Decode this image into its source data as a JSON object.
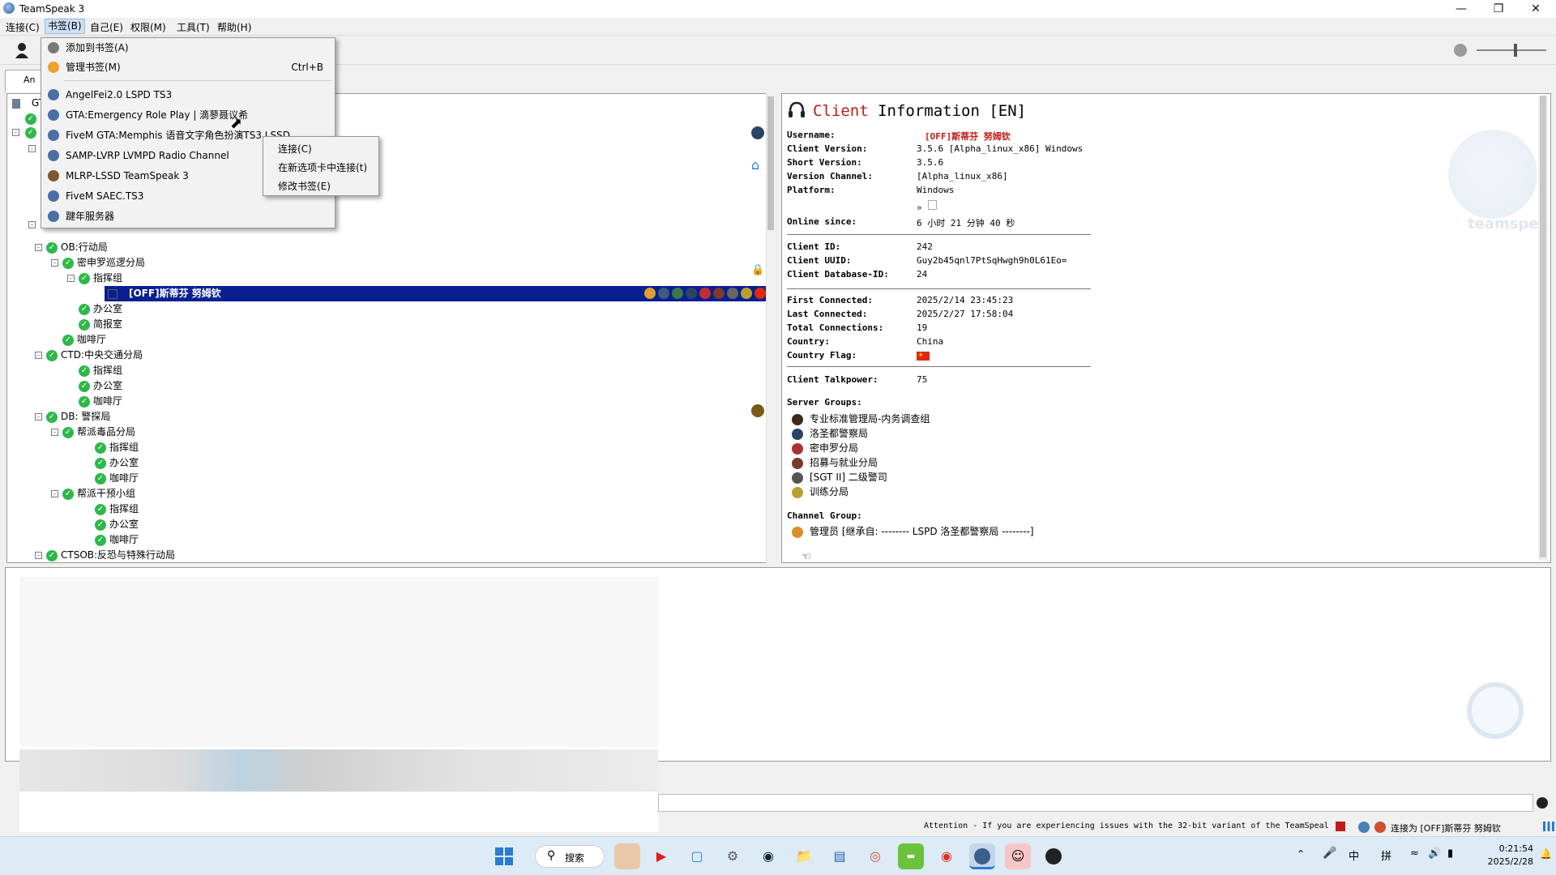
{
  "window": {
    "title": "TeamSpeak 3"
  },
  "menubar": {
    "items": [
      "连接(C)",
      "书签(B)",
      "自己(E)",
      "权限(M)",
      "工具(T)",
      "帮助(H)"
    ]
  },
  "tab": {
    "label": "An"
  },
  "bookmarks_menu": {
    "add": "添加到书签(A)",
    "manage": "管理书签(M)",
    "manage_shortcut": "Ctrl+B",
    "items": [
      "AngelFei2.0 LSPD TS3",
      "GTA:Emergency Role Play | 滴蓼聂议希",
      "FiveM GTA:Memphis 语音文字角色扮演TS3 LSSD",
      "SAMP-LVRP LVMPD Radio Channel",
      "MLRP-LSSD TeamSpeak 3",
      "FiveM SAEC.TS3",
      "踺年服务器"
    ]
  },
  "submenu": {
    "items": [
      "连接(C)",
      "在新选项卡中连接(t)",
      "修改书签(E)"
    ]
  },
  "tree": {
    "top_label": "GTA",
    "nodes": [
      {
        "label": "OB:行动局",
        "level": 1,
        "expand": true
      },
      {
        "label": "密申罗巡逻分局",
        "level": 2,
        "expand": true
      },
      {
        "label": "指挥组",
        "level": 3,
        "expand": true
      },
      {
        "label": "[OFF]斯蒂芬 努姆钦",
        "level": 4,
        "selected": true
      },
      {
        "label": "办公室",
        "level": 3
      },
      {
        "label": "简报室",
        "level": 3
      },
      {
        "label": "咖啡厅",
        "level": 2
      },
      {
        "label": "CTD:中央交通分局",
        "level": 1,
        "expand": true
      },
      {
        "label": "指挥组",
        "level": 3
      },
      {
        "label": "办公室",
        "level": 3
      },
      {
        "label": "咖啡厅",
        "level": 3
      },
      {
        "label": "DB: 警探局",
        "level": 1,
        "expand": true
      },
      {
        "label": "帮派毒品分局",
        "level": 2,
        "expand": true
      },
      {
        "label": "指挥组",
        "level": 4
      },
      {
        "label": "办公室",
        "level": 4
      },
      {
        "label": "咖啡厅",
        "level": 4
      },
      {
        "label": "帮派干预小组",
        "level": 2,
        "expand": true
      },
      {
        "label": "指挥组",
        "level": 4
      },
      {
        "label": "办公室",
        "level": 4
      },
      {
        "label": "咖啡厅",
        "level": 4
      },
      {
        "label": "CTSOB:反恐与特殊行动局",
        "level": 1,
        "expand": true
      }
    ]
  },
  "client_info": {
    "title_red": "Client",
    "title_rest": " Information [EN]",
    "watermark": "teamspeak",
    "rows1": [
      {
        "k": "Username:",
        "v": "[OFF]斯蒂芬 努姆钦"
      },
      {
        "k": "Client Version:",
        "v": "3.5.6 [Alpha_linux_x86] Windows"
      },
      {
        "k": "Short Version:",
        "v": "3.5.6"
      },
      {
        "k": "Version Channel:",
        "v": "[Alpha_linux_x86]"
      },
      {
        "k": "Platform:",
        "v": "Windows"
      }
    ],
    "platform_arrow": "»",
    "online": {
      "k": "Online since:",
      "v": "6 小时 21 分钟 40 秒"
    },
    "rows2": [
      {
        "k": "Client ID:",
        "v": "242"
      },
      {
        "k": "Client UUID:",
        "v": "Guy2b45qnl7PtSqHwgh9h0L61Eo="
      },
      {
        "k": "Client Database-ID:",
        "v": "24"
      }
    ],
    "rows3": [
      {
        "k": "First Connected:",
        "v": "2025/2/14 23:45:23"
      },
      {
        "k": "Last Connected:",
        "v": "2025/2/27 17:58:04"
      },
      {
        "k": "Total Connections:",
        "v": "19"
      },
      {
        "k": "Country:",
        "v": "China"
      },
      {
        "k": "Country Flag:",
        "v": ""
      }
    ],
    "talkpower": {
      "k": "Client Talkpower:",
      "v": "75"
    },
    "server_groups_label": "Server Groups:",
    "server_groups": [
      {
        "name": "专业标准管理局-内务调查组",
        "color": "#3b2a1a"
      },
      {
        "name": "洛圣都警察局",
        "color": "#2a4466"
      },
      {
        "name": "密申罗分局",
        "color": "#a33"
      },
      {
        "name": "招募与就业分局",
        "color": "#7a3b2a"
      },
      {
        "name": "[SGT  II]  二级警司",
        "color": "#555"
      },
      {
        "name": "训练分局",
        "color": "#b8a030"
      }
    ],
    "channel_group_label": "Channel Group:",
    "channel_group": "管理员 [继承自: -------- LSPD 洛圣都警察局 --------]"
  },
  "statusbar": {
    "attention": "Attention - If you are experiencing issues with the 32-bit variant of the TeamSpeal",
    "connected": "连接为 [OFF]斯蒂芬 努姆钦"
  },
  "taskbar": {
    "search": "搜索",
    "ime1": "中",
    "ime2": "拼",
    "time": "0:21:54",
    "date": "2025/2/28"
  },
  "colors": {
    "selection": "#0a1f8f",
    "accent_red": "#c41818",
    "check": "#2fb84a"
  }
}
